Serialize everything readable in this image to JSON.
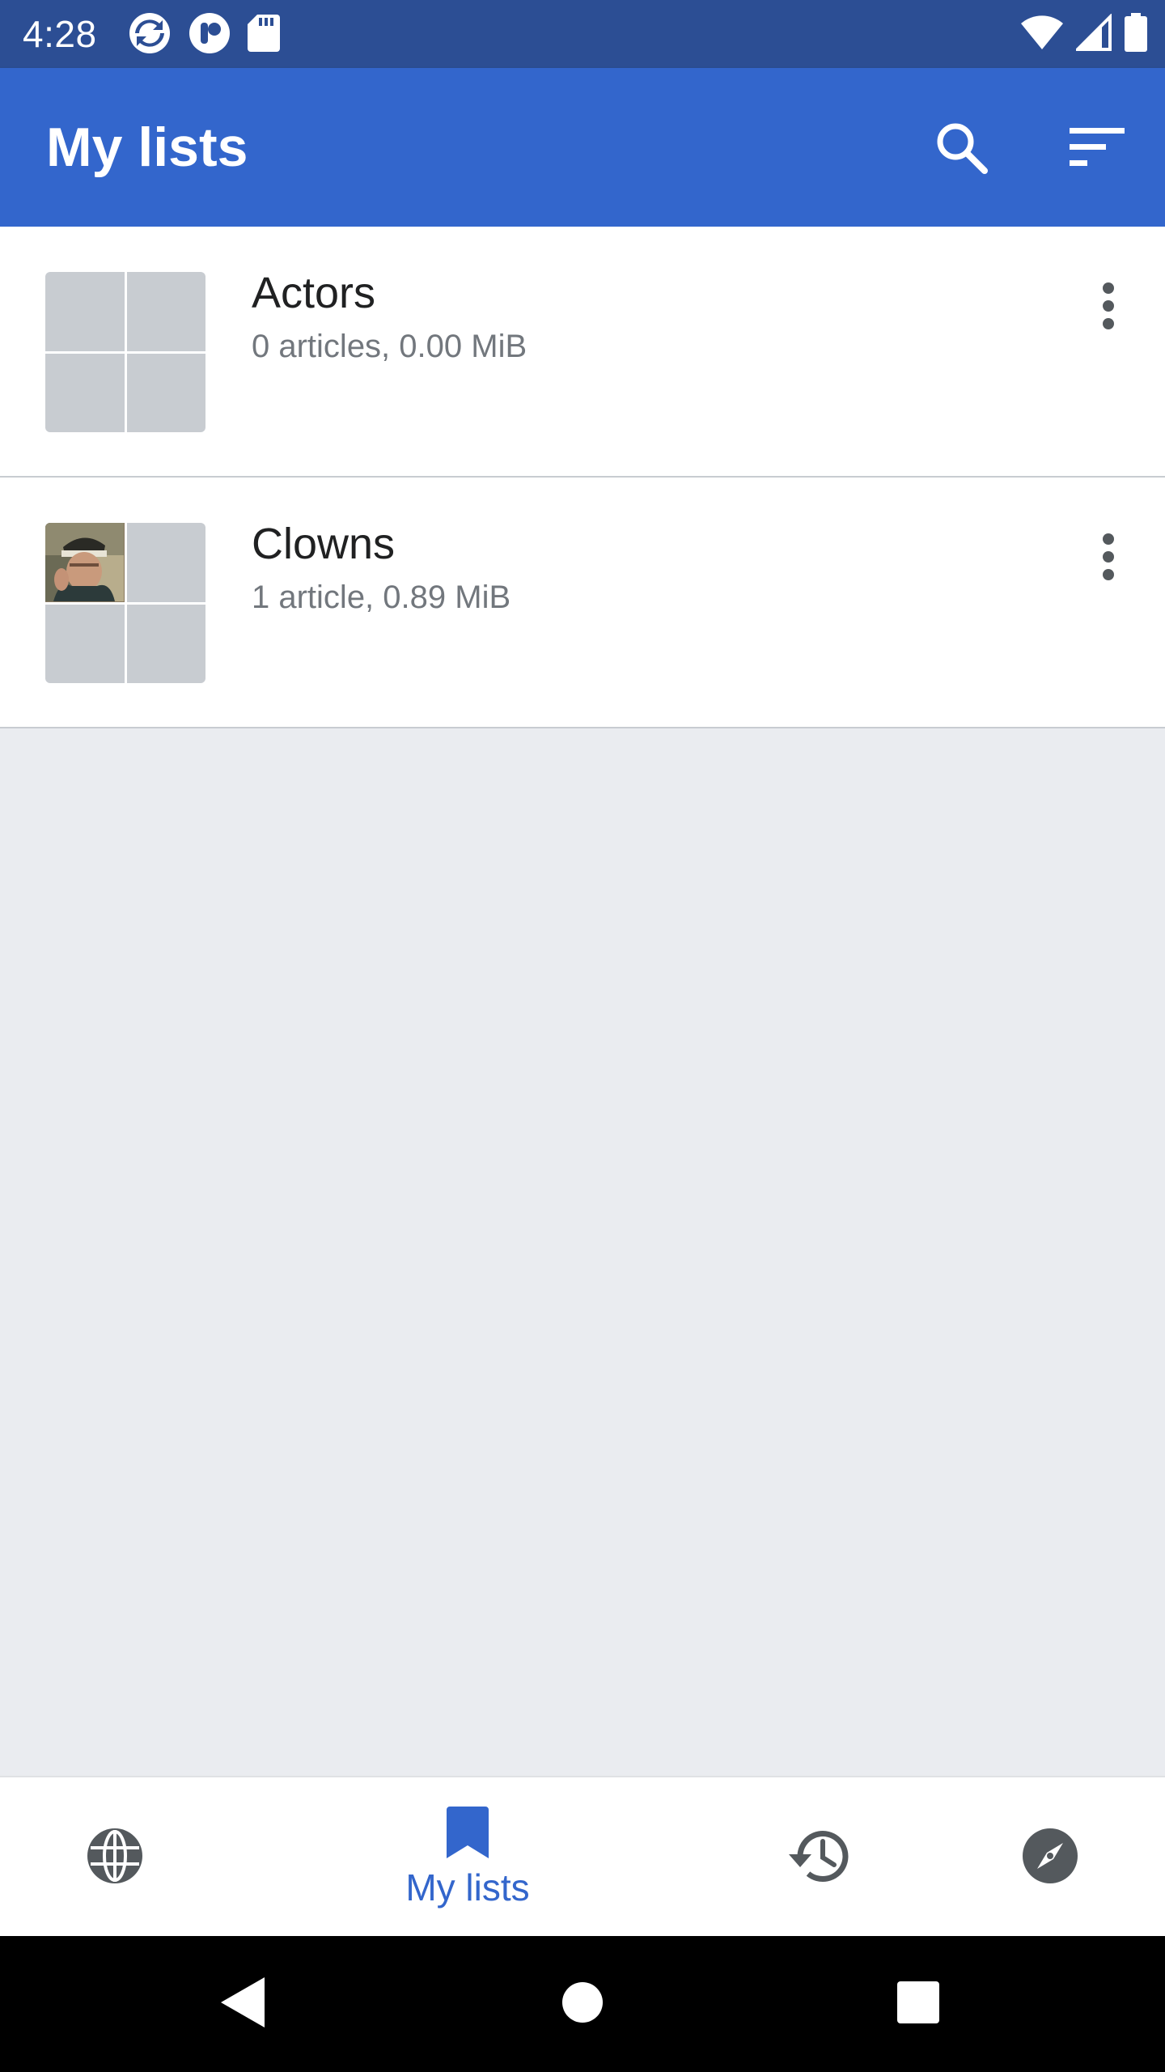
{
  "status_bar": {
    "time": "4:28",
    "left_icons": [
      "sync-notification-icon",
      "app-notification-icon",
      "sd-card-icon"
    ],
    "right_icons": [
      "wifi-icon",
      "cell-signal-icon",
      "battery-icon"
    ]
  },
  "app_bar": {
    "title": "My lists",
    "actions": [
      "search-icon",
      "sort-icon"
    ]
  },
  "lists": [
    {
      "title": "Actors",
      "subtitle": "0 articles, 0.00 MiB",
      "has_image": false
    },
    {
      "title": "Clowns",
      "subtitle": "1 article, 0.89 MiB",
      "has_image": true
    }
  ],
  "bottom_nav": {
    "items": [
      {
        "icon": "globe-icon",
        "label": ""
      },
      {
        "icon": "bookmark-icon",
        "label": "My lists",
        "active": true
      },
      {
        "icon": "history-icon",
        "label": ""
      },
      {
        "icon": "compass-icon",
        "label": ""
      }
    ]
  },
  "colors": {
    "status_bar": "#2c4e94",
    "app_bar": "#3366cc",
    "accent": "#3366cc",
    "background": "#eaecf0",
    "icon_gray": "#54595d"
  }
}
